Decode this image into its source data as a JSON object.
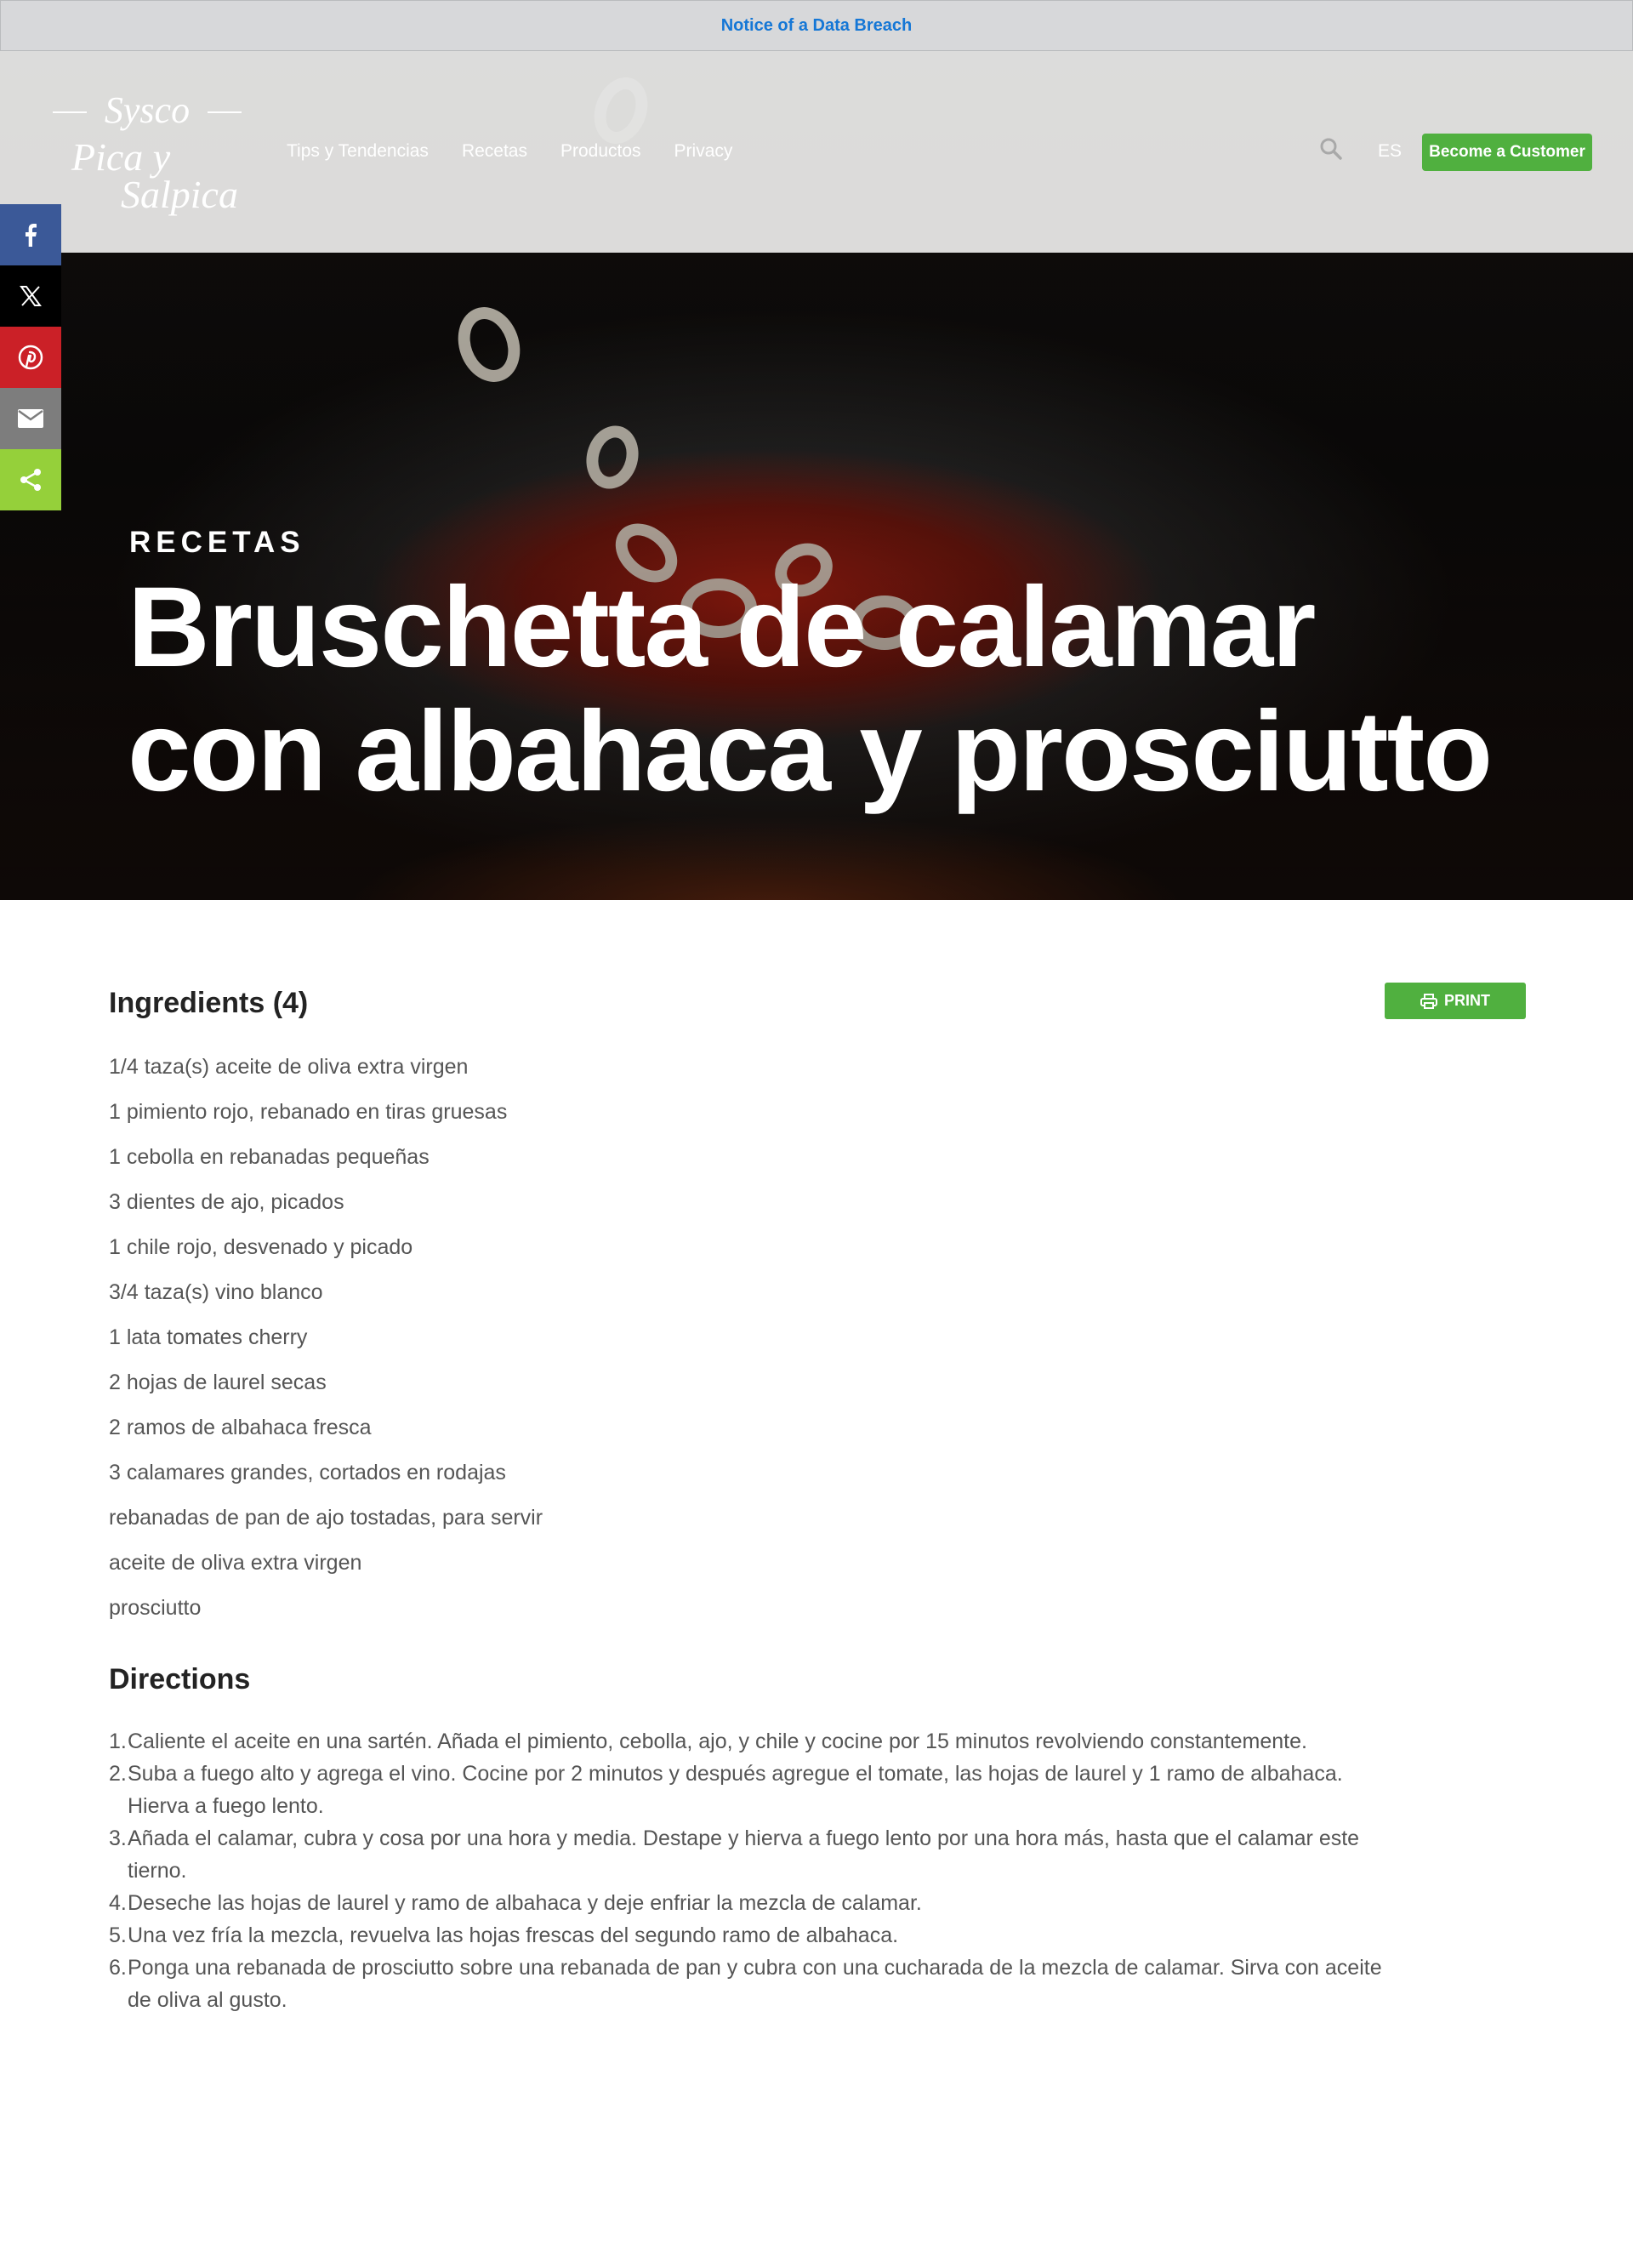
{
  "notice": {
    "label": "Notice of a Data Breach"
  },
  "brand": {
    "line1": "Sysco",
    "line2": "Pica y",
    "line3": "Salpica"
  },
  "nav": {
    "items": [
      {
        "label": "Tips y Tendencias"
      },
      {
        "label": "Recetas"
      },
      {
        "label": "Productos"
      },
      {
        "label": "Privacy"
      }
    ],
    "language": "ES",
    "cta": "Become a Customer"
  },
  "share": {
    "buttons": [
      "facebook-icon",
      "x-icon",
      "pinterest-icon",
      "mail-icon",
      "share-icon"
    ]
  },
  "hero": {
    "eyebrow": "RECETAS",
    "title_line1": "Bruschetta de calamar",
    "title_line2": "con albahaca y prosciutto"
  },
  "ingredients": {
    "heading": "Ingredients (4)",
    "print_label": "PRINT",
    "items": [
      "1/4 taza(s) aceite de oliva extra virgen",
      "1 pimiento rojo, rebanado en tiras gruesas",
      "1 cebolla en rebanadas pequeñas",
      "3 dientes de ajo, picados",
      "1 chile rojo, desvenado y picado",
      "3/4 taza(s) vino blanco",
      "1 lata tomates cherry",
      "2 hojas de laurel secas",
      "2 ramos de albahaca fresca",
      "3 calamares grandes, cortados en rodajas",
      "rebanadas de pan de ajo tostadas, para servir",
      "aceite de oliva extra virgen",
      "prosciutto"
    ]
  },
  "directions": {
    "heading": "Directions",
    "steps": [
      {
        "num": "1.",
        "text": "Caliente el aceite en una sartén. Añada el pimiento, cebolla, ajo, y chile y cocine por 15 minutos revolviendo constantemente."
      },
      {
        "num": "2.",
        "text": "Suba a fuego alto y agrega el vino. Cocine por 2 minutos y después agregue el tomate, las hojas de laurel y 1 ramo de albahaca. Hierva a fuego lento."
      },
      {
        "num": "3.",
        "text": "Añada el calamar, cubra y cosa por una hora y media. Destape y hierva a fuego lento por una hora más, hasta que el calamar este tierno."
      },
      {
        "num": "4.",
        "text": "Deseche las hojas de laurel y ramo de albahaca y deje enfriar la mezcla de calamar."
      },
      {
        "num": "5.",
        "text": "Una vez fría la mezcla, revuelva las hojas frescas del segundo ramo de albahaca."
      },
      {
        "num": "6.",
        "text": "Ponga una rebanada de prosciutto sobre una rebanada de pan y cubra con una cucharada de la mezcla de calamar. Sirva con aceite de oliva al gusto."
      }
    ]
  },
  "colors": {
    "accent_green": "#50b03f",
    "notice_link": "#1577d6",
    "facebook": "#3b5998",
    "pinterest": "#cb2027",
    "share": "#95d03a"
  }
}
